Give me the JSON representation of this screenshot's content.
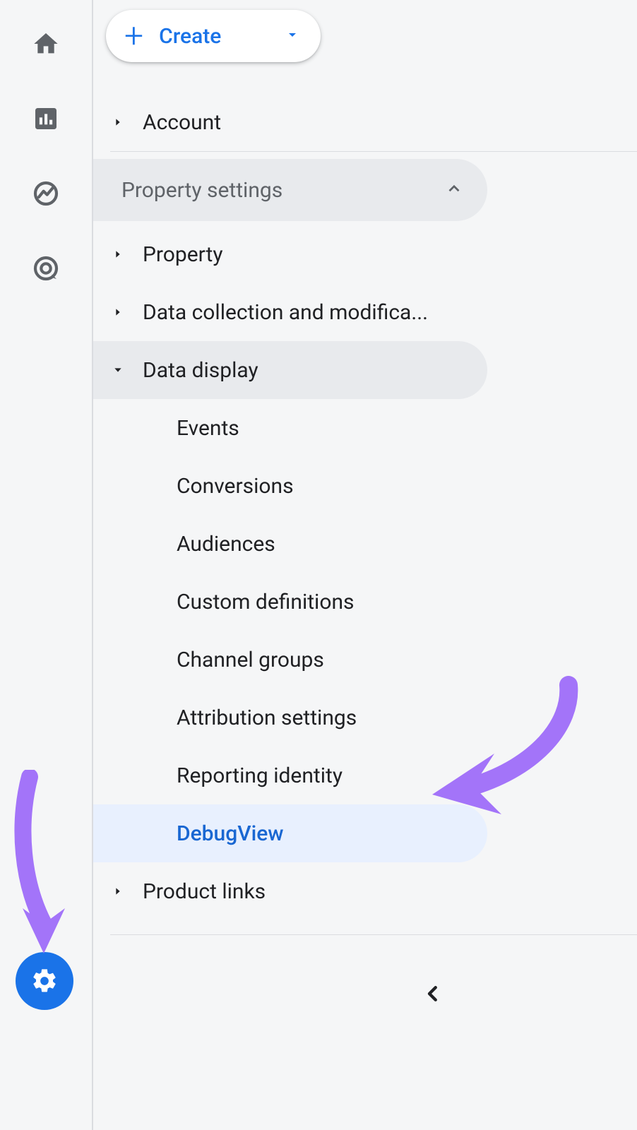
{
  "create_button": {
    "label": "Create"
  },
  "tree": {
    "account": {
      "label": "Account"
    },
    "section_header": {
      "label": "Property settings"
    },
    "property": {
      "label": "Property"
    },
    "data_collection": {
      "label": "Data collection and modifica..."
    },
    "data_display": {
      "label": "Data display"
    },
    "data_display_items": [
      {
        "label": "Events"
      },
      {
        "label": "Conversions"
      },
      {
        "label": "Audiences"
      },
      {
        "label": "Custom definitions"
      },
      {
        "label": "Channel groups"
      },
      {
        "label": "Attribution settings"
      },
      {
        "label": "Reporting identity"
      },
      {
        "label": "DebugView"
      }
    ],
    "product_links": {
      "label": "Product links"
    }
  }
}
